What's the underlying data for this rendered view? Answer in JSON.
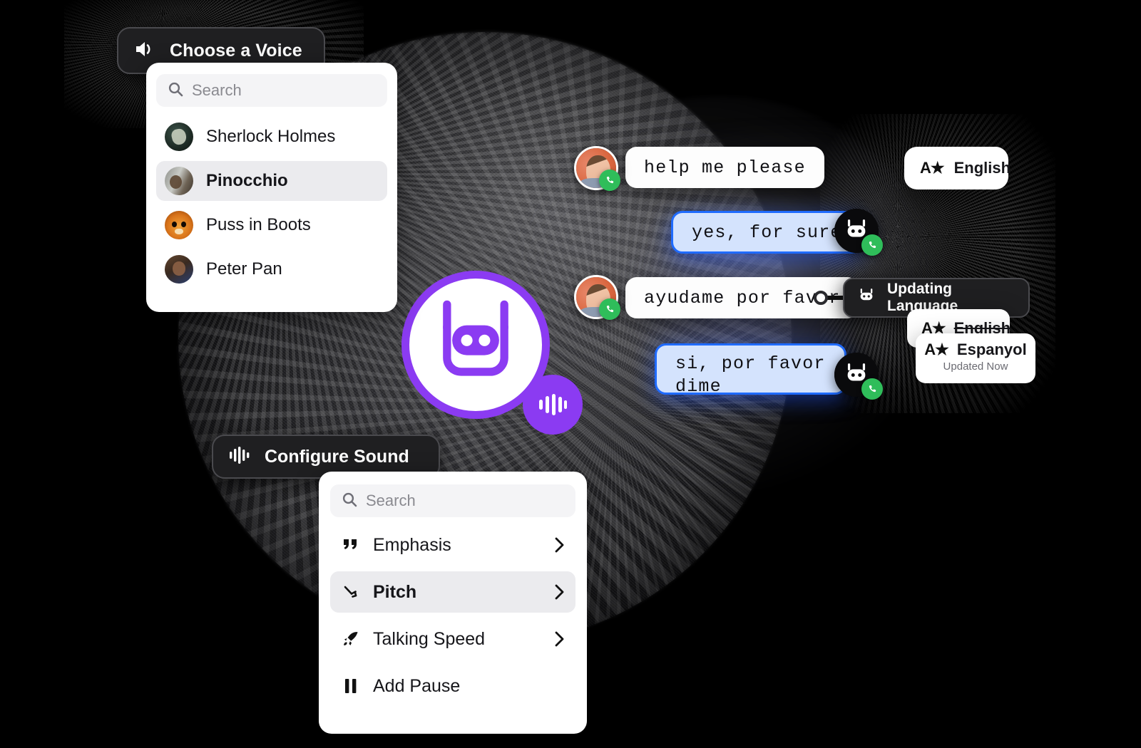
{
  "voice_menu": {
    "trigger_label": "Choose a Voice",
    "trigger_icon": "speaker-icon",
    "search_placeholder": "Search",
    "search_icon": "search-icon",
    "items": [
      {
        "label": "Sherlock Holmes",
        "selected": false
      },
      {
        "label": "Pinocchio",
        "selected": true
      },
      {
        "label": "Puss in Boots",
        "selected": false
      },
      {
        "label": "Peter Pan",
        "selected": false
      }
    ]
  },
  "sound_menu": {
    "trigger_label": "Configure Sound",
    "trigger_icon": "waveform-icon",
    "search_placeholder": "Search",
    "search_icon": "search-icon",
    "items": [
      {
        "label": "Emphasis",
        "icon": "quote-icon",
        "selected": false,
        "chevron": true
      },
      {
        "label": "Pitch",
        "icon": "pitch-arrow-icon",
        "selected": true,
        "chevron": true
      },
      {
        "label": "Talking Speed",
        "icon": "rocket-icon",
        "selected": false,
        "chevron": true
      },
      {
        "label": "Add Pause",
        "icon": "pause-icon",
        "selected": false,
        "chevron": false
      }
    ]
  },
  "conversation": {
    "messages": [
      {
        "text": "help me please",
        "side": "user",
        "style": "white"
      },
      {
        "text": "yes, for sure",
        "side": "bot",
        "style": "blue"
      },
      {
        "text": "ayudame por favor",
        "side": "user",
        "style": "white"
      },
      {
        "text": "si, por favor\ndime",
        "side": "bot",
        "style": "blue"
      }
    ],
    "user_avatar": "woman-avatar",
    "bot_avatar": "robot-avatar",
    "status_badge_icon": "phone-icon"
  },
  "language": {
    "current_label": "English",
    "current_icon": "translate-a-star-icon",
    "updating_label": "Updating Language",
    "updating_icon": "robot-icon",
    "previous_label": "English",
    "previous_icon": "translate-a-star-icon",
    "new_label": "Espanyol",
    "new_icon": "translate-a-star-icon",
    "new_status": "Updated Now"
  },
  "brand": {
    "logo_icon": "robot-logo",
    "badge_icon": "waveform-badge",
    "accent_purple": "#8b3bf2",
    "bubble_blue_border": "#1f6bff",
    "bubble_blue_fill": "#d4e3fd",
    "status_green": "#2fbd5a",
    "dark_surface": "#1f1f21"
  }
}
